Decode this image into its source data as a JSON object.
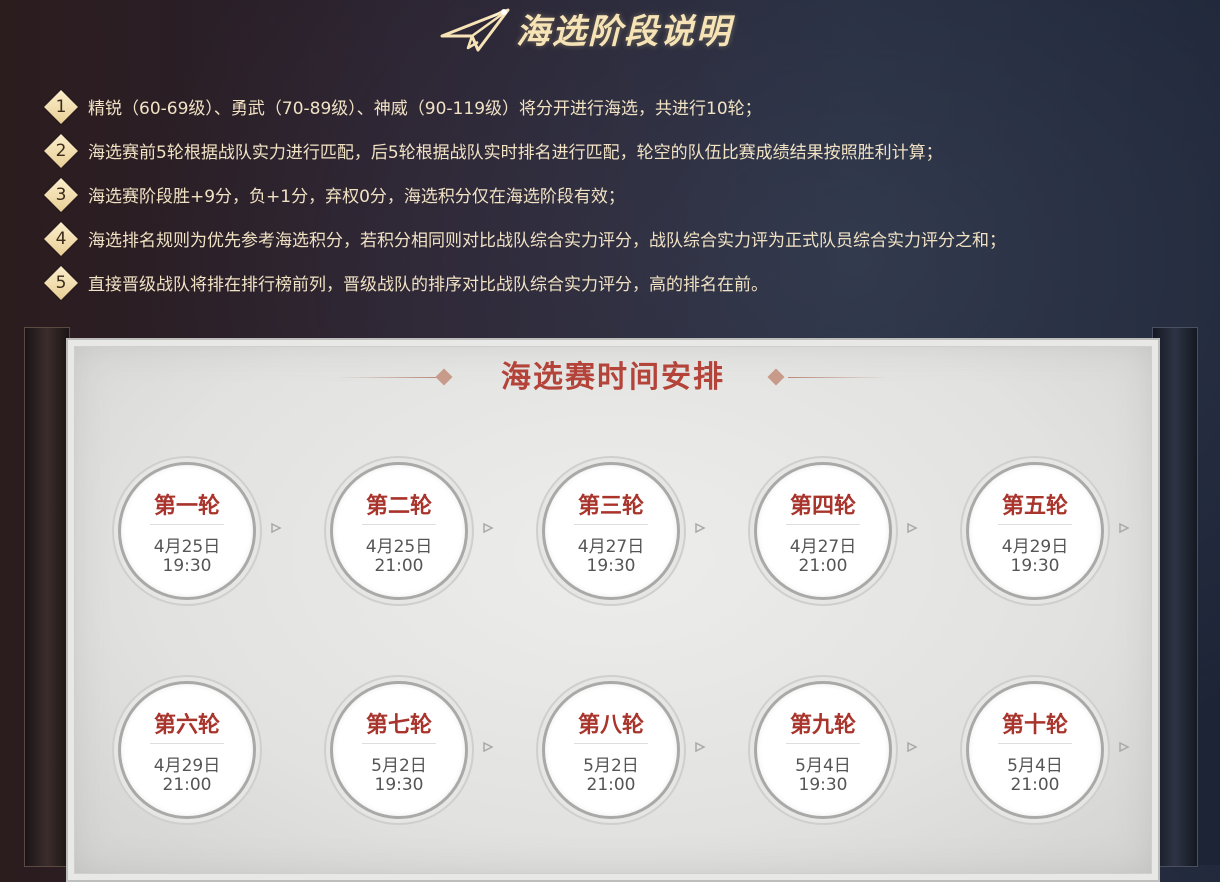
{
  "header": {
    "title": "海选阶段说明",
    "icon": "paper-plane-icon",
    "title_color": "#f6e3b6"
  },
  "rules": [
    {
      "num": "1",
      "text": "精锐（60-69级）、勇武（70-89级）、神威（90-119级）将分开进行海选，共进行10轮；"
    },
    {
      "num": "2",
      "text": "海选赛前5轮根据战队实力进行匹配，后5轮根据战队实时排名进行匹配，轮空的队伍比赛成绩结果按照胜利计算；"
    },
    {
      "num": "3",
      "text": "海选赛阶段胜+9分，负+1分，弃权0分，海选积分仅在海选阶段有效；"
    },
    {
      "num": "4",
      "text": "海选排名规则为优先参考海选积分，若积分相同则对比战队综合实力评分，战队综合实力评为正式队员综合实力评分之和；"
    },
    {
      "num": "5",
      "text": "直接晋级战队将排在排行榜前列，晋级战队的排序对比战队综合实力评分，高的排名在前。"
    }
  ],
  "schedule": {
    "title": "海选赛时间安排",
    "title_color": "#b4443a",
    "rounds": [
      {
        "name": "第一轮",
        "date": "4月25日",
        "time": "19:30"
      },
      {
        "name": "第二轮",
        "date": "4月25日",
        "time": "21:00"
      },
      {
        "name": "第三轮",
        "date": "4月27日",
        "time": "19:30"
      },
      {
        "name": "第四轮",
        "date": "4月27日",
        "time": "21:00"
      },
      {
        "name": "第五轮",
        "date": "4月29日",
        "time": "19:30"
      },
      {
        "name": "第六轮",
        "date": "4月29日",
        "time": "21:00"
      },
      {
        "name": "第七轮",
        "date": "5月2日",
        "time": "19:30"
      },
      {
        "name": "第八轮",
        "date": "5月2日",
        "time": "21:00"
      },
      {
        "name": "第九轮",
        "date": "5月4日",
        "time": "19:30"
      },
      {
        "name": "第十轮",
        "date": "5月4日",
        "time": "21:00"
      }
    ]
  }
}
